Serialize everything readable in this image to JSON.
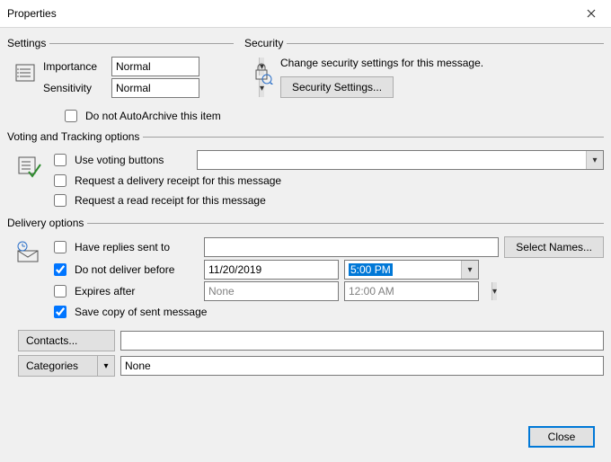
{
  "window": {
    "title": "Properties"
  },
  "settings": {
    "legend": "Settings",
    "importance_label": "Importance",
    "importance_value": "Normal",
    "sensitivity_label": "Sensitivity",
    "sensitivity_value": "Normal",
    "autoarchive_label": "Do not AutoArchive this item"
  },
  "security": {
    "legend": "Security",
    "message": "Change security settings for this message.",
    "button": "Security Settings..."
  },
  "voting": {
    "legend": "Voting and Tracking options",
    "use_voting_label": "Use voting buttons",
    "voting_combo_value": "",
    "delivery_receipt_label": "Request a delivery receipt for this message",
    "read_receipt_label": "Request a read receipt for this message"
  },
  "delivery": {
    "legend": "Delivery options",
    "have_replies_label": "Have replies sent to",
    "replies_value": "",
    "select_names_button": "Select Names...",
    "do_not_deliver_label": "Do not deliver before",
    "do_not_deliver_date": "11/20/2019",
    "do_not_deliver_time": "5:00 PM",
    "expires_label": "Expires after",
    "expires_date": "None",
    "expires_time": "12:00 AM",
    "save_copy_label": "Save copy of sent message",
    "contacts_button": "Contacts...",
    "contacts_value": "",
    "categories_button": "Categories",
    "categories_value": "None"
  },
  "footer": {
    "close": "Close"
  }
}
